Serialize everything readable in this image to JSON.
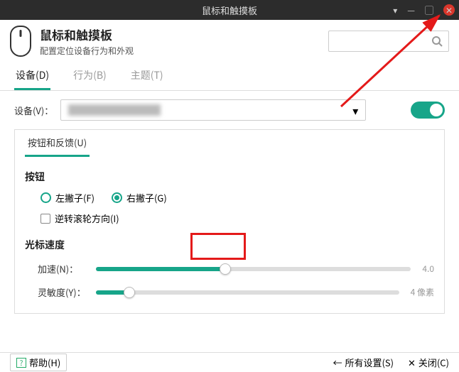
{
  "window": {
    "title": "鼠标和触摸板"
  },
  "header": {
    "title": "鼠标和触摸板",
    "subtitle": "配置定位设备行为和外观"
  },
  "tabs": {
    "device": "设备(D)",
    "behavior": "行为(B)",
    "theme": "主题(T)"
  },
  "device_row": {
    "label": "设备(V)："
  },
  "subtab": {
    "label": "按钮和反馈(U)"
  },
  "buttons_section": {
    "title": "按钮",
    "left_handed": "左撇子(F)",
    "right_handed": "右撇子(G)",
    "reverse_scroll": "逆转滚轮方向(I)"
  },
  "cursor_section": {
    "title": "光标速度",
    "accel_label": "加速(N)：",
    "accel_value": "4.0",
    "sens_label": "灵敏度(Y)：",
    "sens_value": "4 像素"
  },
  "footer": {
    "help": "帮助(H)",
    "all_settings": "所有设置(S)",
    "close": "关闭(C)"
  },
  "colors": {
    "accent": "#17a589",
    "red": "#e41a1a"
  }
}
